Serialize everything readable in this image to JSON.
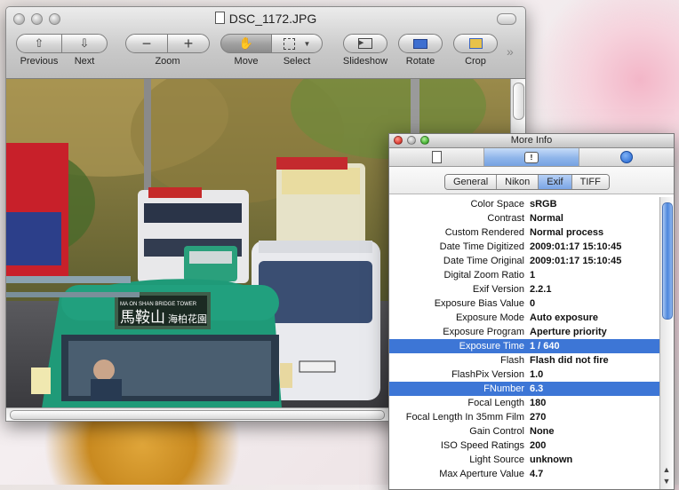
{
  "preview": {
    "title": "DSC_1172.JPG",
    "toolbar": {
      "previous": "Previous",
      "next": "Next",
      "zoom": "Zoom",
      "move": "Move",
      "select": "Select",
      "slideshow": "Slideshow",
      "rotate": "Rotate",
      "crop": "Crop"
    },
    "image_sign": {
      "line1": "MA ON SHAN  BRIDGE TOWER",
      "line2_left": "馬鞍山",
      "line2_right": "海柏花園"
    }
  },
  "info": {
    "title": "More Info",
    "tabs": [
      "General",
      "Nikon",
      "Exif",
      "TIFF"
    ],
    "selected_tab": "Exif",
    "rows": [
      {
        "key": "Color Space",
        "value": "sRGB"
      },
      {
        "key": "Contrast",
        "value": "Normal"
      },
      {
        "key": "Custom Rendered",
        "value": "Normal process"
      },
      {
        "key": "Date Time Digitized",
        "value": "2009:01:17 15:10:45"
      },
      {
        "key": "Date Time Original",
        "value": "2009:01:17 15:10:45"
      },
      {
        "key": "Digital Zoom Ratio",
        "value": "1"
      },
      {
        "key": "Exif Version",
        "value": "2.2.1"
      },
      {
        "key": "Exposure Bias Value",
        "value": "0"
      },
      {
        "key": "Exposure Mode",
        "value": "Auto exposure"
      },
      {
        "key": "Exposure Program",
        "value": "Aperture priority"
      },
      {
        "key": "Exposure Time",
        "value": "1 / 640",
        "selected": true
      },
      {
        "key": "Flash",
        "value": "Flash did not fire"
      },
      {
        "key": "FlashPix Version",
        "value": "1.0"
      },
      {
        "key": "FNumber",
        "value": "6.3",
        "selected": true
      },
      {
        "key": "Focal Length",
        "value": "180"
      },
      {
        "key": "Focal Length In 35mm Film",
        "value": "270"
      },
      {
        "key": "Gain Control",
        "value": "None"
      },
      {
        "key": "ISO Speed Ratings",
        "value": "200"
      },
      {
        "key": "Light Source",
        "value": "unknown"
      },
      {
        "key": "Max Aperture Value",
        "value": "4.7"
      }
    ]
  },
  "colors": {
    "selection": "#3d76d6",
    "minibus_green": "#1f9a78"
  }
}
